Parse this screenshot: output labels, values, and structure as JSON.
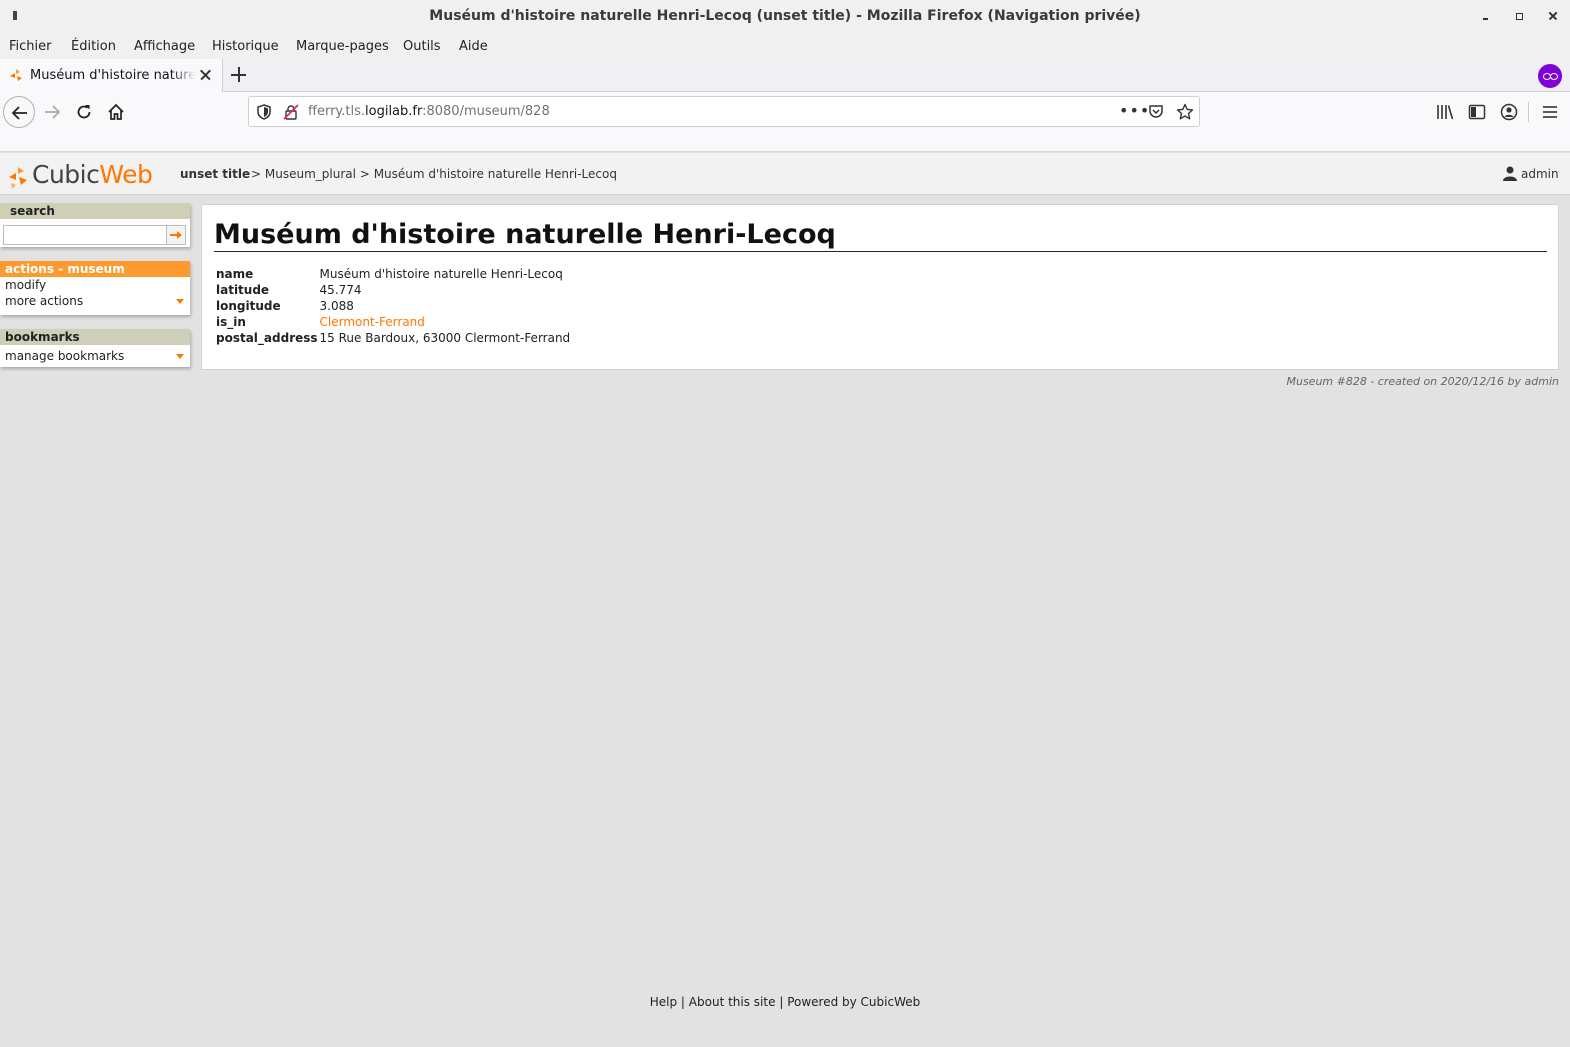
{
  "window": {
    "title": "Muséum d'histoire naturelle Henri-Lecoq (unset title) - Mozilla Firefox (Navigation privée)"
  },
  "menubar": {
    "items": [
      "Fichier",
      "Édition",
      "Affichage",
      "Historique",
      "Marque-pages",
      "Outils",
      "Aide"
    ]
  },
  "tab": {
    "label": "Muséum d'histoire naturelle Henri-Lecoq (unset title)"
  },
  "urlbar": {
    "prefix": "fferry.tls.",
    "domain": "logilab.fr",
    "suffix": ":8080/museum/828"
  },
  "header": {
    "logo_part1": "Cubic",
    "logo_part2": "Web",
    "site_title": "unset title",
    "breadcrumb": {
      "sep1": ">",
      "crumb1": "Museum_plural",
      "sep2": ">",
      "crumb2": "Muséum d'histoire naturelle Henri-Lecoq"
    },
    "user": "admin"
  },
  "sidebar": {
    "search": {
      "title": "search",
      "value": ""
    },
    "actions": {
      "title": "actions - museum",
      "items": [
        "modify",
        "more actions"
      ]
    },
    "bookmarks": {
      "title": "bookmarks",
      "items": [
        "manage bookmarks"
      ]
    }
  },
  "entity": {
    "title": "Muséum d'histoire naturelle Henri-Lecoq",
    "attributes": [
      {
        "key": "name",
        "value": "Muséum d'histoire naturelle Henri-Lecoq"
      },
      {
        "key": "latitude",
        "value": "45.774"
      },
      {
        "key": "longitude",
        "value": "3.088"
      },
      {
        "key": "is_in",
        "value": "Clermont-Ferrand"
      },
      {
        "key": "postal_address",
        "value": "15 Rue Bardoux, 63000 Clermont-Ferrand"
      }
    ],
    "meta": "Museum #828 - created on 2020/12/16 by admin"
  },
  "footer": {
    "help": "Help",
    "sep": "|",
    "about": "About this site",
    "powered": "Powered by CubicWeb"
  },
  "colors": {
    "accent": "#ff7700",
    "actions_header": "#ff9a2f",
    "box_header": "#cfceb7",
    "private": "#8000d7"
  }
}
